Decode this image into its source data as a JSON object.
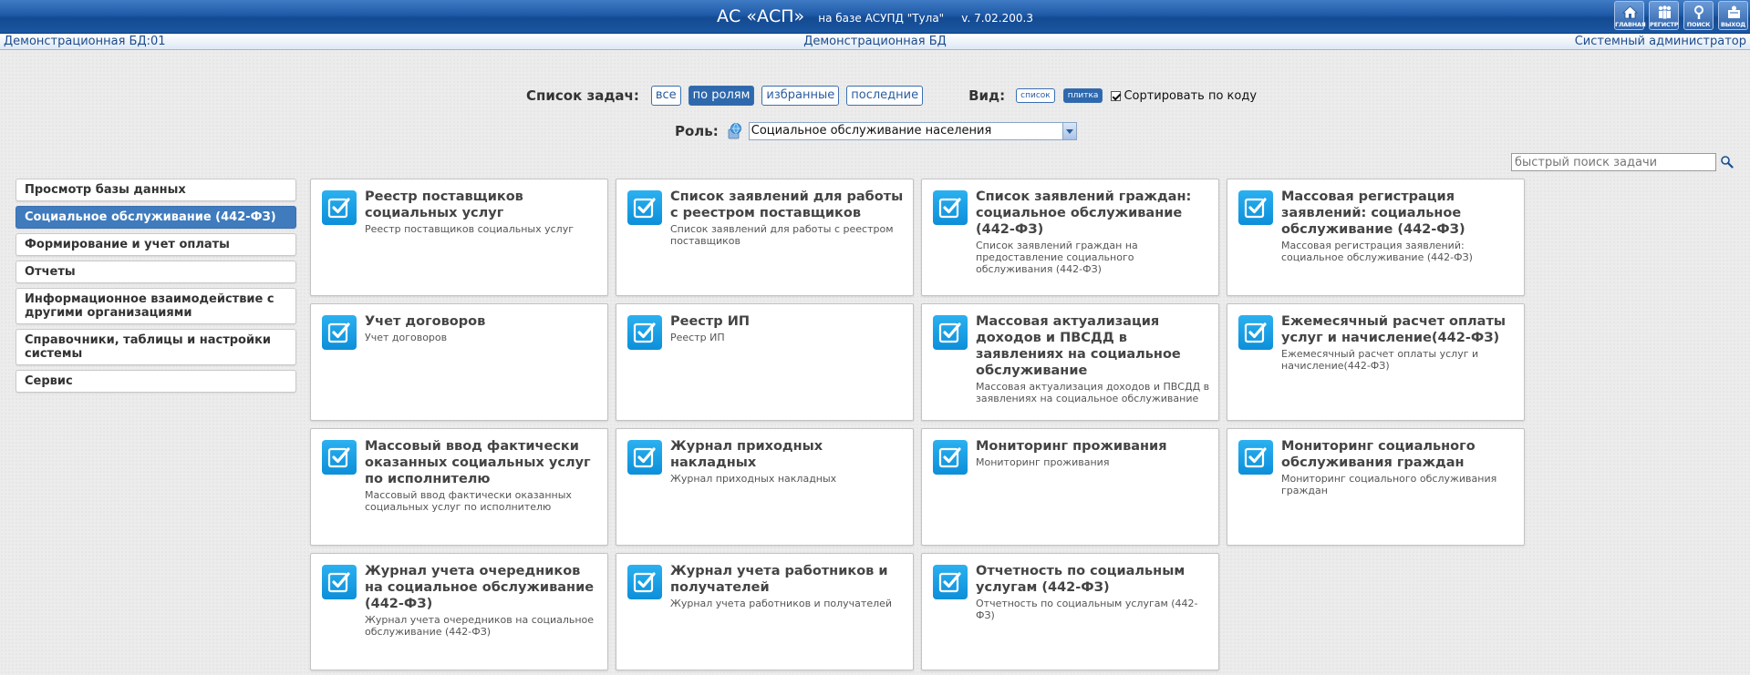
{
  "header": {
    "title_main": "АС «АСП»",
    "title_sub": "на базе АСУПД \"Тула\"",
    "version": "v. 7.02.200.3",
    "buttons": [
      {
        "label": "ГЛАВНАЯ",
        "icon": "home-icon"
      },
      {
        "label": "РЕГИСТР",
        "icon": "registry-icon"
      },
      {
        "label": "ПОИСК",
        "icon": "search-icon"
      },
      {
        "label": "ВЫХОД",
        "icon": "exit-icon"
      }
    ]
  },
  "infobar": {
    "left": "Демонстрационная БД:01",
    "center": "Демонстрационная БД",
    "right": "Системный администратор"
  },
  "filters": {
    "label": "Список задач:",
    "buttons": [
      "все",
      "по ролям",
      "избранные",
      "последние"
    ],
    "active": "по ролям",
    "view_label": "Вид:",
    "view_buttons": [
      "список",
      "плитка"
    ],
    "view_active": "плитка",
    "sort_label": "Сортировать по коду",
    "sort_checked": true
  },
  "role": {
    "label": "Роль:",
    "value": "Социальное обслуживание населения"
  },
  "search": {
    "placeholder": "быстрый поиск задачи"
  },
  "sidebar": {
    "items": [
      "Просмотр базы данных",
      "Социальное обслуживание (442-ФЗ)",
      "Формирование и учет оплаты",
      "Отчеты",
      "Информационное взаимодействие с другими организациями",
      "Справочники, таблицы и настройки системы",
      "Сервис"
    ],
    "active_index": 1
  },
  "colors": {
    "accent": "#2e68ad",
    "tile_icon": "#0c8fd9",
    "header": "#1f5aa8"
  },
  "tiles": [
    {
      "title": "Реестр поставщиков социальных услуг",
      "desc": "Реестр поставщиков социальных услуг"
    },
    {
      "title": "Список заявлений для работы с реестром поставщиков",
      "desc": "Список заявлений для работы с реестром поставщиков"
    },
    {
      "title": "Список заявлений граждан: социальное обслуживание (442-ФЗ)",
      "desc": "Список заявлений граждан на предоставление социального обслуживания (442-ФЗ)"
    },
    {
      "title": "Массовая регистрация заявлений: социальное обслуживание (442-ФЗ)",
      "desc": "Массовая регистрация заявлений: социальное обслуживание (442-ФЗ)"
    },
    {
      "title": "Учет договоров",
      "desc": "Учет договоров"
    },
    {
      "title": "Реестр ИП",
      "desc": "Реестр ИП"
    },
    {
      "title": "Массовая актуализация доходов и ПВСДД в заявлениях на социальное обслуживание",
      "desc": "Массовая актуализация доходов и ПВСДД в заявлениях на социальное обслуживание"
    },
    {
      "title": "Ежемесячный расчет оплаты услуг и начисление(442-ФЗ)",
      "desc": "Ежемесячный расчет оплаты услуг и начисление(442-ФЗ)"
    },
    {
      "title": "Массовый ввод фактически оказанных социальных услуг по исполнителю",
      "desc": "Массовый ввод фактически оказанных социальных услуг по исполнителю"
    },
    {
      "title": "Журнал приходных накладных",
      "desc": "Журнал приходных накладных"
    },
    {
      "title": "Мониторинг проживания",
      "desc": "Мониторинг проживания"
    },
    {
      "title": "Мониторинг социального обслуживания граждан",
      "desc": "Мониторинг социального обслуживания граждан"
    },
    {
      "title": "Журнал учета очередников на социальное обслуживание (442-ФЗ)",
      "desc": "Журнал учета очередников на социальное обслуживание (442-ФЗ)"
    },
    {
      "title": "Журнал учета работников и получателей",
      "desc": "Журнал учета работников и получателей"
    },
    {
      "title": "Отчетность по социальным услугам (442-ФЗ)",
      "desc": "Отчетность по социальным услугам (442-ФЗ)"
    }
  ]
}
